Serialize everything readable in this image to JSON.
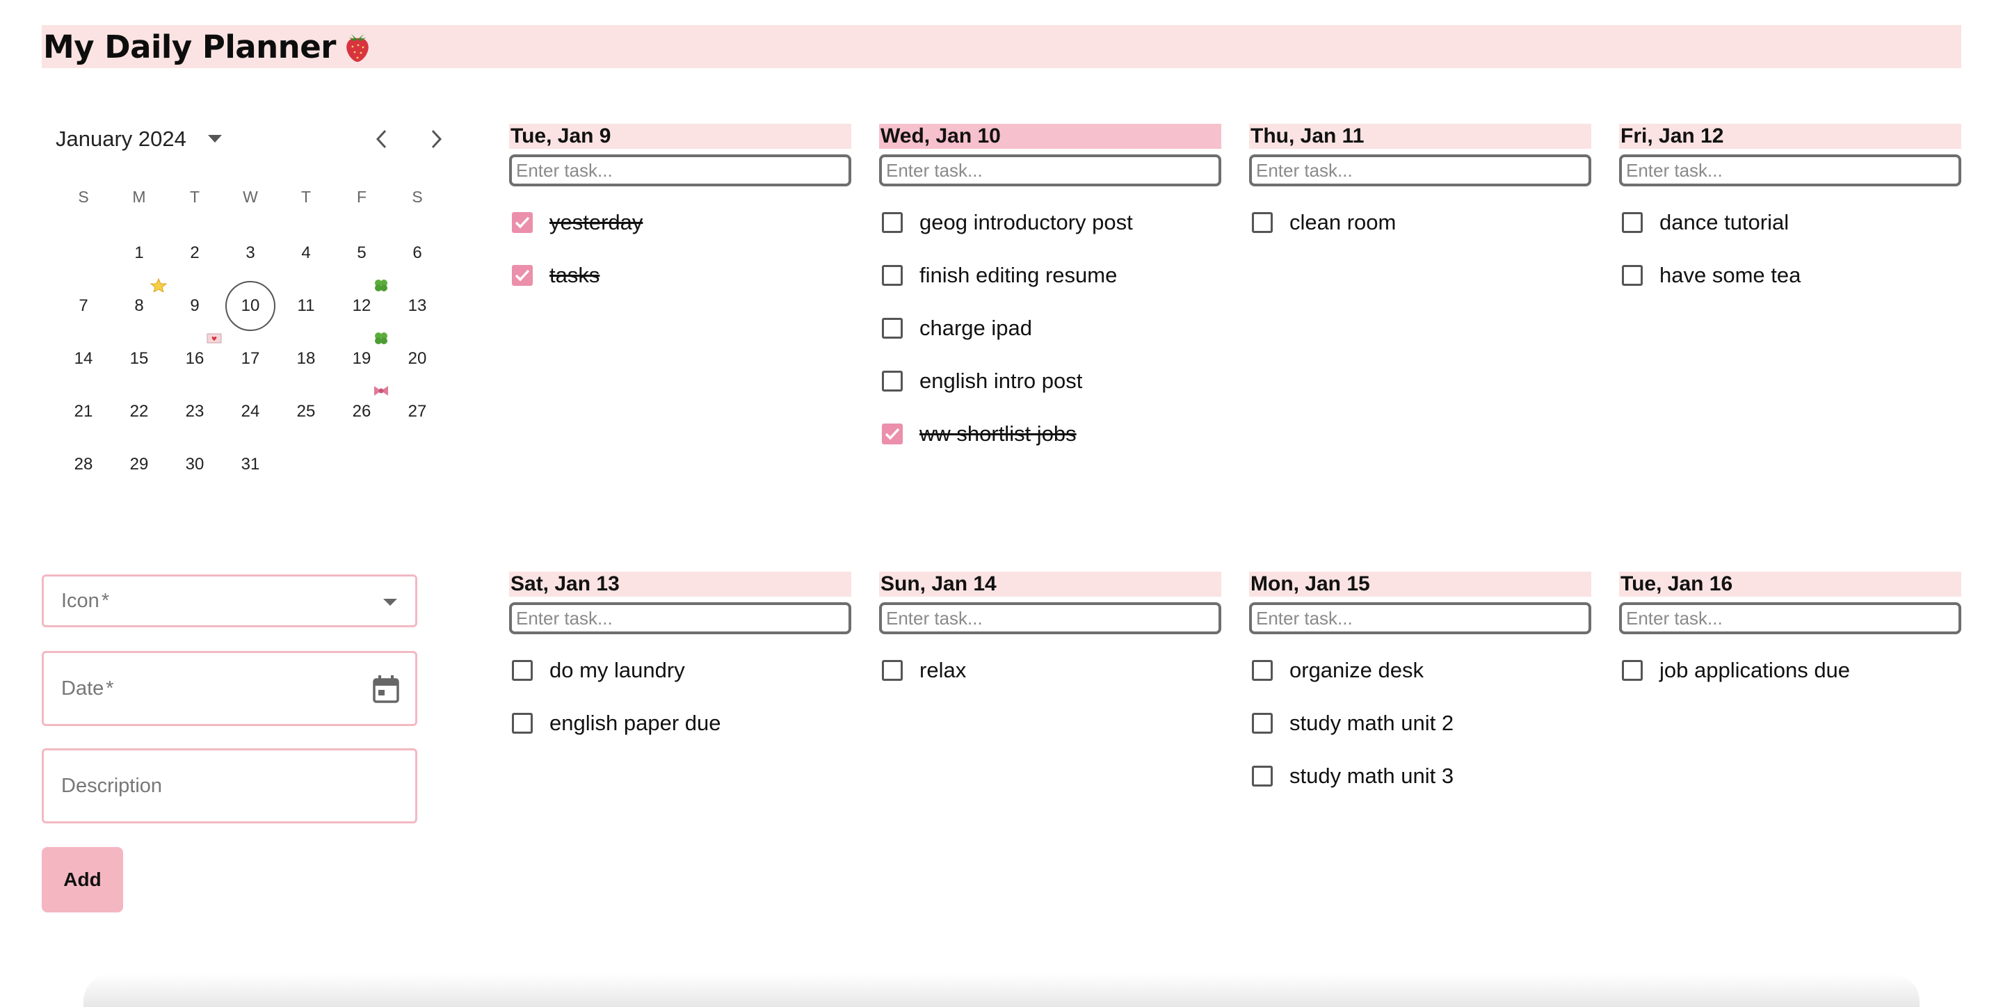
{
  "app": {
    "title": "My Daily Planner",
    "title_icon": "strawberry-icon"
  },
  "calendar": {
    "month_label": "January 2024",
    "weekdays": [
      "S",
      "M",
      "T",
      "W",
      "T",
      "F",
      "S"
    ],
    "weeks": [
      [
        "",
        "1",
        "2",
        "3",
        "4",
        "5",
        "6"
      ],
      [
        "7",
        "8",
        "9",
        "10",
        "11",
        "12",
        "13"
      ],
      [
        "14",
        "15",
        "16",
        "17",
        "18",
        "19",
        "20"
      ],
      [
        "21",
        "22",
        "23",
        "24",
        "25",
        "26",
        "27"
      ],
      [
        "28",
        "29",
        "30",
        "31",
        "",
        "",
        ""
      ]
    ],
    "today": "10",
    "markers": [
      {
        "day": "8",
        "icon": "star-icon"
      },
      {
        "day": "12",
        "icon": "clover-icon"
      },
      {
        "day": "16",
        "icon": "love-letter-icon"
      },
      {
        "day": "19",
        "icon": "clover-icon"
      },
      {
        "day": "26",
        "icon": "ribbon-icon"
      }
    ]
  },
  "form": {
    "icon_label": "Icon",
    "date_label": "Date",
    "required_mark": "*",
    "description_label": "Description",
    "add_label": "Add"
  },
  "task_placeholder": "Enter task...",
  "days": [
    {
      "label": "Tue, Jan 9",
      "selected": false,
      "tasks": [
        {
          "text": "yesterday",
          "done": true
        },
        {
          "text": "tasks",
          "done": true
        }
      ]
    },
    {
      "label": "Wed, Jan 10",
      "selected": true,
      "tasks": [
        {
          "text": "geog introductory post",
          "done": false
        },
        {
          "text": "finish editing resume",
          "done": false
        },
        {
          "text": "charge ipad",
          "done": false
        },
        {
          "text": "english intro post",
          "done": false
        },
        {
          "text": "ww shortlist jobs",
          "done": true
        }
      ]
    },
    {
      "label": "Thu, Jan 11",
      "selected": false,
      "tasks": [
        {
          "text": "clean room",
          "done": false
        }
      ]
    },
    {
      "label": "Fri, Jan 12",
      "selected": false,
      "tasks": [
        {
          "text": "dance tutorial",
          "done": false
        },
        {
          "text": "have some tea",
          "done": false
        }
      ]
    },
    {
      "label": "Sat, Jan 13",
      "selected": false,
      "tasks": [
        {
          "text": "do my laundry",
          "done": false
        },
        {
          "text": "english paper due",
          "done": false
        }
      ]
    },
    {
      "label": "Sun, Jan 14",
      "selected": false,
      "tasks": [
        {
          "text": "relax",
          "done": false
        }
      ]
    },
    {
      "label": "Mon, Jan 15",
      "selected": false,
      "tasks": [
        {
          "text": "organize desk",
          "done": false
        },
        {
          "text": "study math unit 2",
          "done": false
        },
        {
          "text": "study math unit 3",
          "done": false
        }
      ]
    },
    {
      "label": "Tue, Jan 16",
      "selected": false,
      "tasks": [
        {
          "text": "job applications due",
          "done": false
        }
      ]
    }
  ],
  "colors": {
    "header_bg": "#fbe3e3",
    "selected_day_bg": "#f6c1cc",
    "accent_pink": "#eb8fab",
    "button_pink": "#f4b6c1",
    "field_border": "#f3b9c3"
  }
}
